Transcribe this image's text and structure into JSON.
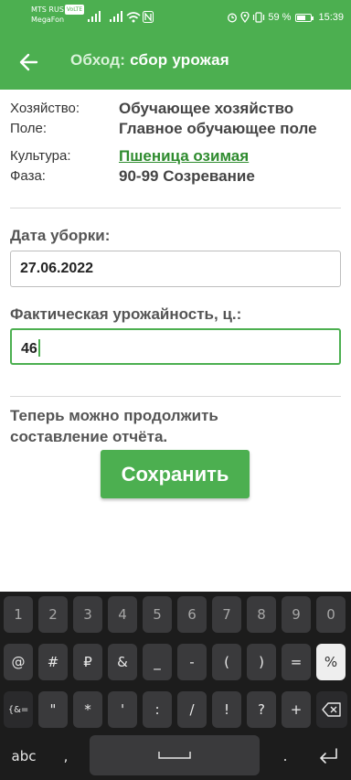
{
  "status_bar": {
    "carrier_line1": "MTS RUS",
    "volte_badge": "VoLTE",
    "carrier_line2": "MegaFon",
    "battery": "59 %",
    "time": "15:39"
  },
  "app_bar": {
    "title_prefix": "Обход:",
    "title_main": "сбор урожая"
  },
  "info": {
    "farm_label": "Хозяйство:",
    "farm_value": "Обучающее хозяйство",
    "field_label": "Поле:",
    "field_value": "Главное обучающее поле",
    "crop_label": "Культура:",
    "crop_value": "Пшеница озимая",
    "phase_label": "Фаза:",
    "phase_value": "90-99 Созревание"
  },
  "form": {
    "date_label": "Дата уборки:",
    "date_value": "27.06.2022",
    "yield_label": "Фактическая урожайность, ц.:",
    "yield_value": "46"
  },
  "note": "Теперь можно продолжить составление отчёта.",
  "save_label": "Сохранить",
  "keyboard": {
    "row1": [
      "1",
      "2",
      "3",
      "4",
      "5",
      "6",
      "7",
      "8",
      "9",
      "0"
    ],
    "row2": [
      "@",
      "#",
      "₽",
      "&",
      "_",
      "-",
      "(",
      ")",
      "=",
      "%"
    ],
    "row3": [
      "{&=",
      "\"",
      "*",
      "'",
      ":",
      "/",
      "!",
      "?",
      "+"
    ],
    "abc_label": "abc",
    "comma": ",",
    "period": "."
  },
  "colors": {
    "accent": "#4caf50",
    "link": "#2e8b2e",
    "keyboard_bg": "#1c1c1c",
    "key_bg": "#3a3a3c"
  }
}
